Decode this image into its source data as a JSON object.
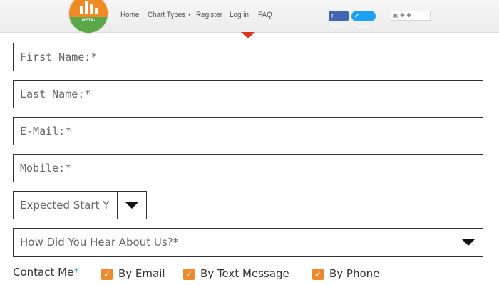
{
  "header": {
    "logo_text": "META-",
    "nav": [
      {
        "label": "Home"
      },
      {
        "label": "Chart Types",
        "caret": "▼"
      },
      {
        "label": "Register"
      },
      {
        "label": "Log in"
      },
      {
        "label": "FAQ"
      }
    ],
    "share_label": "Share",
    "tweet_label": "Tweet",
    "colors": {
      "pointer": "#d9391a",
      "checkbox": "#ef8a2c",
      "required_star": "#2aa0c9"
    }
  },
  "form": {
    "first_name": {
      "placeholder": "First Name:*",
      "value": ""
    },
    "last_name": {
      "placeholder": "Last Name:*",
      "value": ""
    },
    "email": {
      "placeholder": "E-Mail:*",
      "value": ""
    },
    "mobile": {
      "placeholder": "Mobile:*",
      "value": ""
    },
    "expected_start": {
      "label": "Expected Start Y"
    },
    "heard_about": {
      "label": "How Did You Hear About Us?*"
    },
    "contact_me": {
      "label": "Contact Me",
      "required_mark": "*",
      "options": [
        {
          "label": "By Email",
          "checked": true
        },
        {
          "label": "By Text Message",
          "checked": true
        },
        {
          "label": "By Phone",
          "checked": true
        }
      ]
    }
  }
}
